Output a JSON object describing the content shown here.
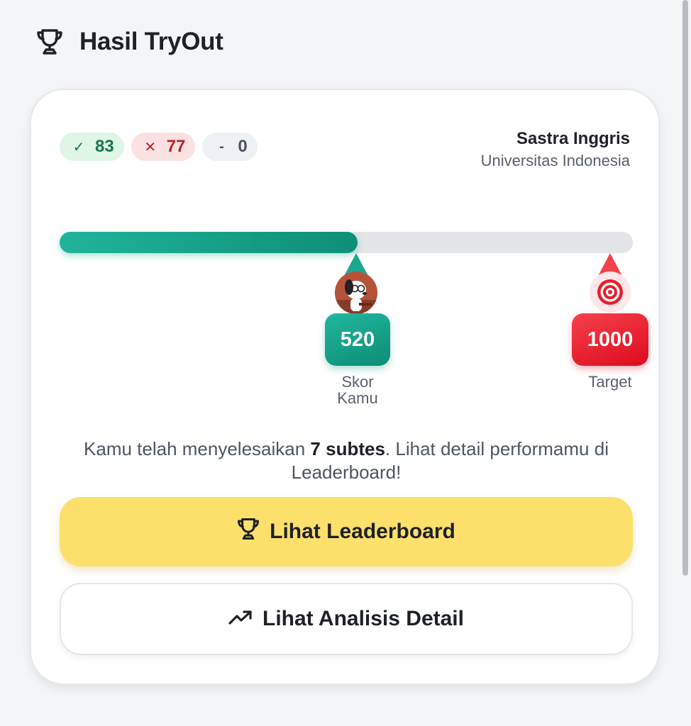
{
  "header": {
    "title": "Hasil TryOut",
    "icon": "trophy-icon"
  },
  "stats": {
    "correct": {
      "symbol": "✓",
      "value": "83",
      "color": "#18794a"
    },
    "wrong": {
      "symbol": "✕",
      "value": "77",
      "color": "#b5232a"
    },
    "blank": {
      "symbol": "-",
      "value": "0",
      "color": "#4b5361"
    }
  },
  "program": {
    "major": "Sastra Inggris",
    "university": "Universitas Indonesia"
  },
  "progress": {
    "score": 520,
    "target": 1000,
    "fraction": 0.52
  },
  "score": {
    "value": "520",
    "label_line1": "Skor",
    "label_line2": "Kamu",
    "color": "#14a08a"
  },
  "target": {
    "value": "1000",
    "label": "Target",
    "color": "#ea1c2a"
  },
  "summary": {
    "before": "Kamu telah menyelesaikan ",
    "highlight": "7 subtes",
    "after": ". Lihat detail performamu di Leaderboard!"
  },
  "buttons": {
    "leaderboard": {
      "label": "Lihat Leaderboard",
      "icon": "trophy-icon",
      "color": "#fddf6c"
    },
    "analysis": {
      "label": "Lihat Analisis Detail",
      "icon": "trending-up-icon"
    }
  }
}
